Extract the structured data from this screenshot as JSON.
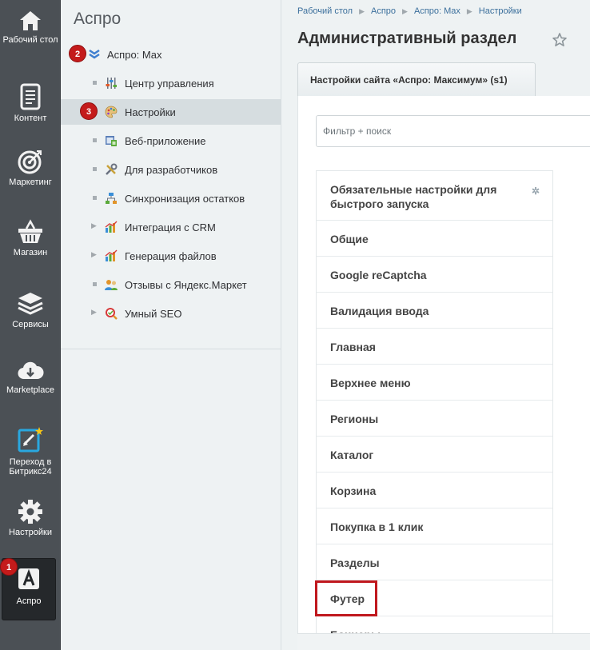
{
  "rail": {
    "items": [
      {
        "label": "Рабочий стол",
        "icon": "home-icon"
      },
      {
        "label": "Контент",
        "icon": "document-icon"
      },
      {
        "label": "Маркетинг",
        "icon": "target-icon"
      },
      {
        "label": "Магазин",
        "icon": "basket-icon"
      },
      {
        "label": "Сервисы",
        "icon": "layers-icon"
      },
      {
        "label": "Marketplace",
        "icon": "cloud-download-icon"
      },
      {
        "label": "Переход в Битрикс24",
        "icon": "bitrix24-icon"
      },
      {
        "label": "Настройки",
        "icon": "gear-icon"
      },
      {
        "label": "Аспро",
        "icon": "aspro-icon"
      }
    ]
  },
  "badges": {
    "one": "1",
    "two": "2",
    "three": "3"
  },
  "tree": {
    "title": "Аспро",
    "root": "Аспро: Max",
    "items": [
      {
        "label": "Центр управления"
      },
      {
        "label": "Настройки"
      },
      {
        "label": "Веб-приложение"
      },
      {
        "label": "Для разработчиков"
      },
      {
        "label": "Синхронизация остатков"
      },
      {
        "label": "Интеграция с CRM"
      },
      {
        "label": "Генерация файлов"
      },
      {
        "label": "Отзывы с Яндекс.Маркет"
      },
      {
        "label": "Умный SEO"
      }
    ]
  },
  "breadcrumb": [
    "Рабочий стол",
    "Аспро",
    "Аспро: Max",
    "Настройки"
  ],
  "page_title": "Административный раздел",
  "tab_label": "Настройки сайта «Аспро: Максимум» (s1)",
  "filter": {
    "placeholder": "Фильтр + поиск"
  },
  "settings_list": [
    "Обязательные настройки для быстрого запуска",
    "Общие",
    "Google reCaptcha",
    "Валидация ввода",
    "Главная",
    "Верхнее меню",
    "Регионы",
    "Каталог",
    "Корзина",
    "Покупка в 1 клик",
    "Разделы",
    "Футер",
    "Баннеры"
  ],
  "colors": {
    "accent_red": "#c0181e",
    "link_blue": "#3b6f9c",
    "rail_bg": "#4b5055"
  }
}
